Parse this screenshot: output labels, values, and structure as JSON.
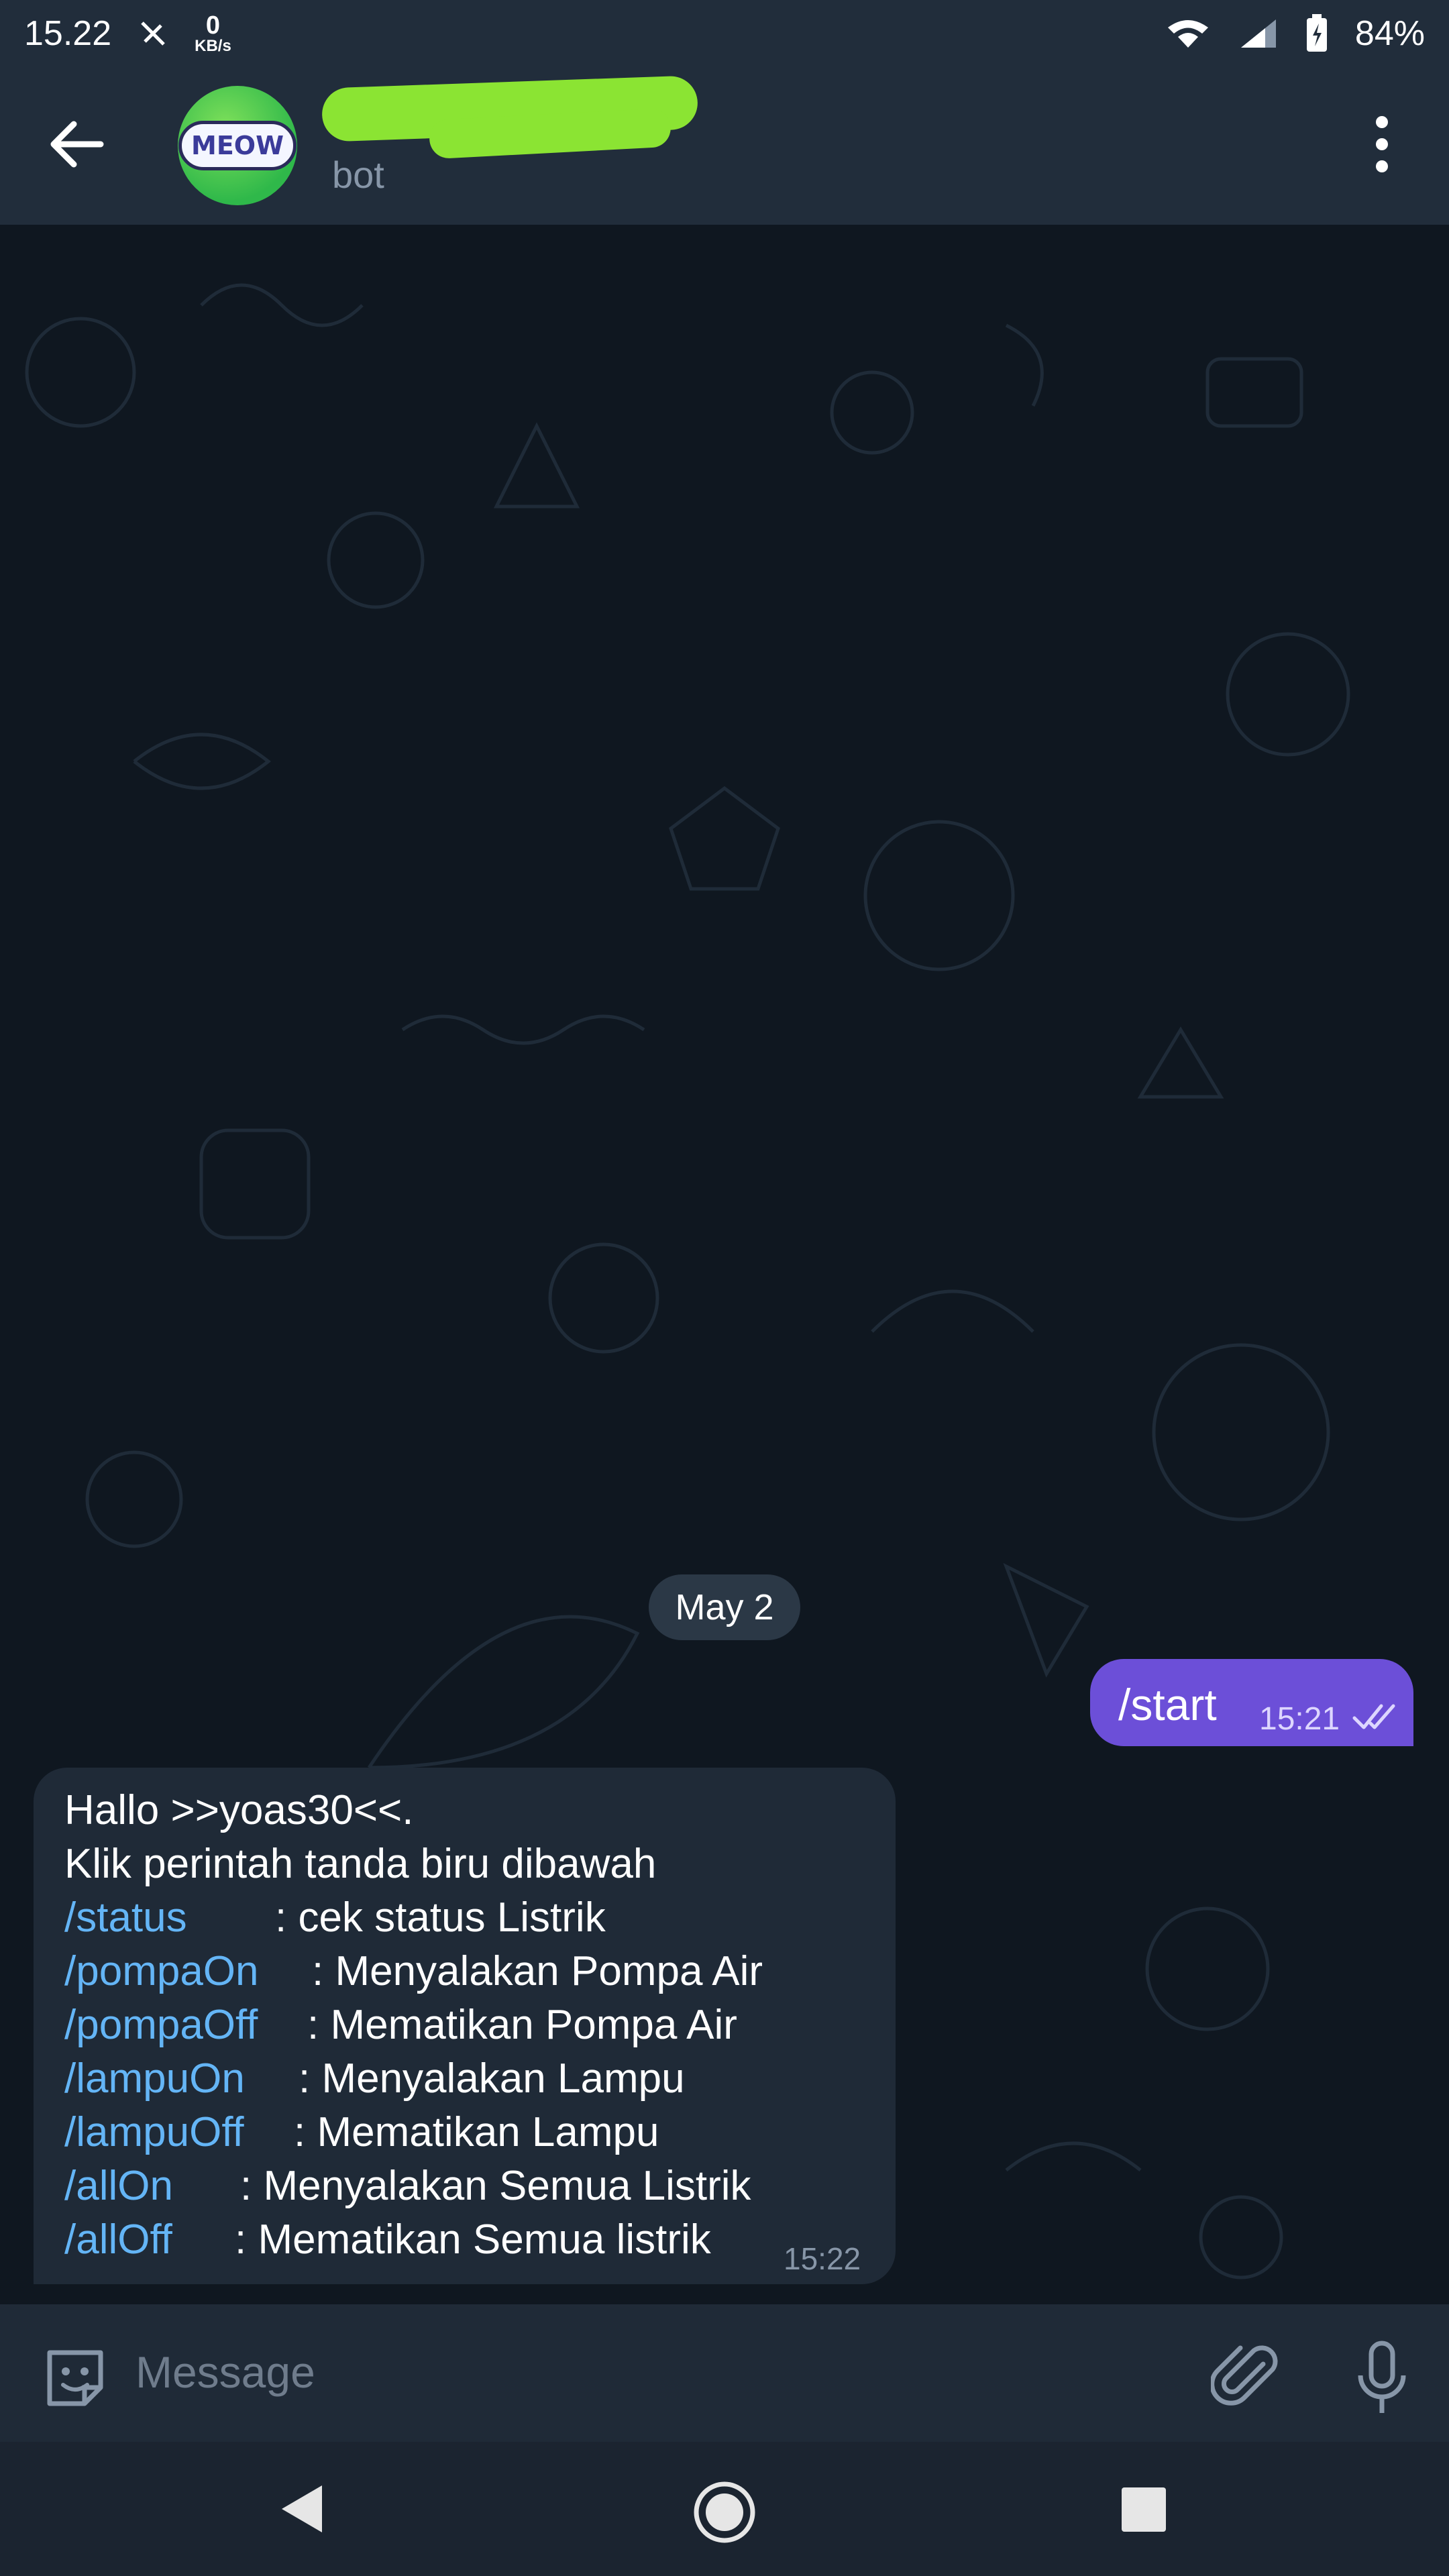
{
  "status_bar": {
    "time": "15.22",
    "net_speed_value": "0",
    "net_speed_unit": "KB/s",
    "battery": "84%"
  },
  "header": {
    "avatar_text": "MEOW",
    "subtitle": "bot"
  },
  "chat": {
    "date": "May 2",
    "outgoing": {
      "text": "/start",
      "time": "15:21"
    },
    "incoming": {
      "line1": "Hallo >>yoas30<<.",
      "line2": "Klik perintah tanda biru dibawah",
      "commands": [
        {
          "cmd": "/status",
          "desc": ": cek status Listrik"
        },
        {
          "cmd": "/pompaOn",
          "desc": ": Menyalakan Pompa Air"
        },
        {
          "cmd": "/pompaOff",
          "desc": ": Mematikan Pompa Air"
        },
        {
          "cmd": "/lampuOn",
          "desc": ": Menyalakan Lampu"
        },
        {
          "cmd": "/lampuOff",
          "desc": ": Mematikan Lampu"
        },
        {
          "cmd": "/allOn",
          "desc": ": Menyalakan Semua Listrik"
        },
        {
          "cmd": "/allOff",
          "desc": ": Mematikan Semua listrik"
        }
      ],
      "time": "15:22"
    }
  },
  "input": {
    "placeholder": "Message"
  },
  "colors": {
    "header_bg": "#212d3b",
    "chat_bg": "#0f1720",
    "outgoing_bubble": "#6c4fd8",
    "incoming_bubble": "#1f2a37",
    "command_link": "#64b5f6"
  }
}
